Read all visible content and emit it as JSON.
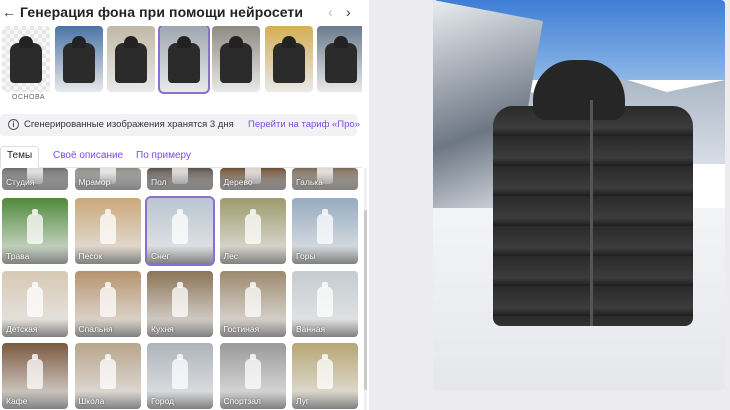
{
  "header": {
    "title": "Генерация фона при помощи нейросети",
    "back_icon": "arrow-left-icon",
    "prev_icon": "chevron-left-icon",
    "next_icon": "chevron-right-icon"
  },
  "carousel": {
    "base_label": "ОСНОВА",
    "items": [
      {
        "bg": "#d8d8d8",
        "selected": false
      },
      {
        "bg": "#4a74a6",
        "selected": false
      },
      {
        "bg": "#c2b8a8",
        "selected": false
      },
      {
        "bg": "#9ea7b0",
        "selected": true
      },
      {
        "bg": "#8e8b82",
        "selected": false
      },
      {
        "bg": "#d4ae55",
        "selected": false
      },
      {
        "bg": "#6a7b8e",
        "selected": false
      }
    ]
  },
  "info": {
    "text": "Сгенерированные изображения хранятся 3 дня",
    "link": "Перейти на тариф «Про»"
  },
  "tabs": {
    "themes": "Темы",
    "own": "Своё описание",
    "example": "По примеру"
  },
  "themes": [
    {
      "label": "Студия",
      "bg": "#6c6c6c",
      "row": 0,
      "col": 0
    },
    {
      "label": "Мрамор",
      "bg": "#8a8a86",
      "row": 0,
      "col": 1
    },
    {
      "label": "Пол",
      "bg": "#5a504a",
      "row": 0,
      "col": 2
    },
    {
      "label": "Дерево",
      "bg": "#6b4d33",
      "row": 0,
      "col": 3
    },
    {
      "label": "Галька",
      "bg": "#7a6a56",
      "row": 0,
      "col": 4
    },
    {
      "label": "Трава",
      "bg": "#4f8a3a",
      "row": 1,
      "col": 0
    },
    {
      "label": "Песок",
      "bg": "#cba87a",
      "row": 1,
      "col": 1
    },
    {
      "label": "Снег",
      "bg": "#b9c6d2",
      "row": 1,
      "col": 2,
      "selected": true
    },
    {
      "label": "Лес",
      "bg": "#9e9a6e",
      "row": 1,
      "col": 3
    },
    {
      "label": "Горы",
      "bg": "#95abc0",
      "row": 1,
      "col": 4
    },
    {
      "label": "Детская",
      "bg": "#d7c9b4",
      "row": 2,
      "col": 0
    },
    {
      "label": "Спальня",
      "bg": "#b5946e",
      "row": 2,
      "col": 1
    },
    {
      "label": "Кухня",
      "bg": "#8c7458",
      "row": 2,
      "col": 2
    },
    {
      "label": "Гостиная",
      "bg": "#9d8a70",
      "row": 2,
      "col": 3
    },
    {
      "label": "Ванная",
      "bg": "#c5ccd0",
      "row": 2,
      "col": 4
    },
    {
      "label": "Кафе",
      "bg": "#7b5a40",
      "row": 3,
      "col": 0
    },
    {
      "label": "Школа",
      "bg": "#b8a58c",
      "row": 3,
      "col": 1
    },
    {
      "label": "Город",
      "bg": "#aeb4bc",
      "row": 3,
      "col": 2
    },
    {
      "label": "Спортзал",
      "bg": "#9a9a9a",
      "row": 3,
      "col": 3
    },
    {
      "label": "Луг",
      "bg": "#b7a676",
      "row": 3,
      "col": 4
    }
  ]
}
